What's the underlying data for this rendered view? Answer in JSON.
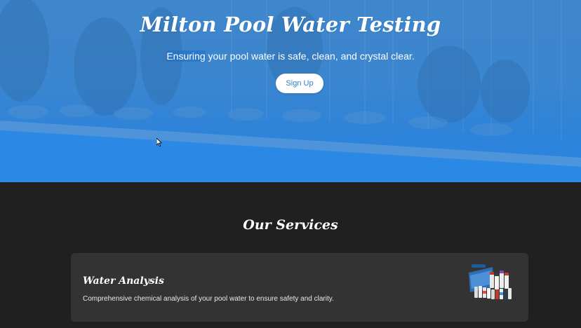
{
  "hero": {
    "title": "Milton Pool Water Testing",
    "subtitle_highlight": "Ensuring",
    "subtitle_rest": " your pool water is safe, clean, and crystal clear.",
    "cta_label": "Sign Up"
  },
  "services": {
    "heading": "Our Services",
    "items": [
      {
        "name": "Water Analysis",
        "description": "Comprehensive chemical analysis of your pool water to ensure safety and clarity.",
        "image": "water-test-kit-image"
      }
    ]
  },
  "colors": {
    "hero_blue": "#3b86d0",
    "dark_bg": "#202020",
    "card_bg": "#333333",
    "button_text": "#2d7fc9"
  }
}
